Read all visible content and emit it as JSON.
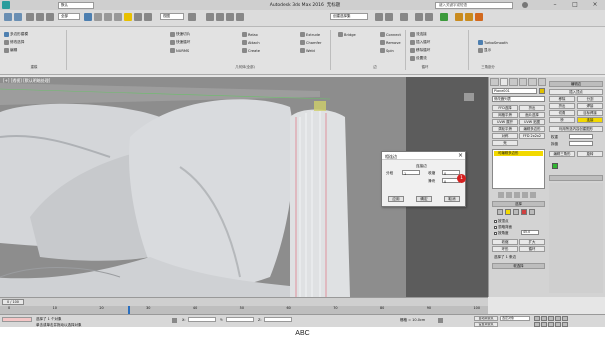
{
  "titlebar": {
    "title": "Autodesk 3ds Max 2016",
    "file": "无标题",
    "search_placeholder": "键入关键字或短语",
    "workspace": "默认"
  },
  "toolbar": {
    "selection_filter": "全部",
    "view_dropdown": "视图",
    "create_selection_set": "创建选择集"
  },
  "ribbon": {
    "sections": [
      {
        "label": "建模",
        "items": [
          "多边形建模",
          "修改选择",
          "编辑"
        ]
      },
      {
        "label": "几何体(全部)",
        "items": [
          "快速切片",
          "快速循环",
          "NURMS",
          "Relax",
          "Attach",
          "Create",
          "Chamfer",
          "Weld"
        ]
      },
      {
        "label": "边",
        "items": [
          "Extrude",
          "Bridge",
          "Connect",
          "Remove",
          "Spin"
        ]
      },
      {
        "label": "循环",
        "items": [
          "流连接",
          "插入循环",
          "移除循环",
          "设置流"
        ]
      },
      {
        "label": "三角剖分",
        "items": [
          "TurboSmooth",
          "显示"
        ]
      }
    ],
    "accent": "#f2c200"
  },
  "viewport": {
    "label": "[+] [透视] [默认明暗处理]",
    "background": "#8b8b8b"
  },
  "dialog": {
    "title": "相连边",
    "group_label": "连接边",
    "field_labels": [
      "分段",
      "收缩",
      "滑块"
    ],
    "field_values": [
      "1",
      "0",
      "0"
    ],
    "buttons": [
      "应用",
      "确定",
      "取消"
    ],
    "marker": "1",
    "marker_color": "#d52020"
  },
  "command_panel": {
    "tabs": [
      "创建",
      "修改",
      "层次",
      "运动",
      "显示",
      "实用程序"
    ],
    "object_name": "Plane001",
    "modifier_list_label": "修改器列表",
    "buttons_left": [
      "FFD选择",
      "网格平滑",
      "UVW 展开",
      "涡轮平滑",
      "对称",
      "壳"
    ],
    "buttons_right": [
      "挤出",
      "面片选择",
      "UVW 贴图",
      "编辑多边形",
      "FFD 2x2x2"
    ],
    "stack_item": "可编辑多边形",
    "section_select": "选择",
    "section_soft": "软选择",
    "section_edit_edges": "编辑边",
    "edge_buttons": [
      "插入顶点",
      "移除",
      "分割",
      "挤出",
      "焊接",
      "切角",
      "目标焊接",
      "桥",
      "连接",
      "利用所选内容创建图形",
      "权重",
      "拆缝",
      "编辑三角形",
      "旋转"
    ],
    "select_options": [
      "按顶点",
      "忽略背面",
      "按角度",
      "45.0"
    ],
    "select_buttons": [
      "收缩",
      "扩大",
      "环形",
      "循环"
    ],
    "status": "选择了 1 条边"
  },
  "timeline": {
    "frame_label": "0 / 100",
    "ticks": [
      "0",
      "10",
      "20",
      "30",
      "40",
      "50",
      "60",
      "70",
      "80",
      "90",
      "100"
    ]
  },
  "statusbar": {
    "left_text": "选择了 1 个对象",
    "hint": "单击或单击并拖动以选择对象",
    "x_label": "X:",
    "y_label": "Y:",
    "z_label": "Z:",
    "grid": "栅格 = 10.0cm",
    "autokey": "自动关键点",
    "setkey": "设置关键点",
    "selected": "选定对象"
  },
  "caption": "ABC"
}
